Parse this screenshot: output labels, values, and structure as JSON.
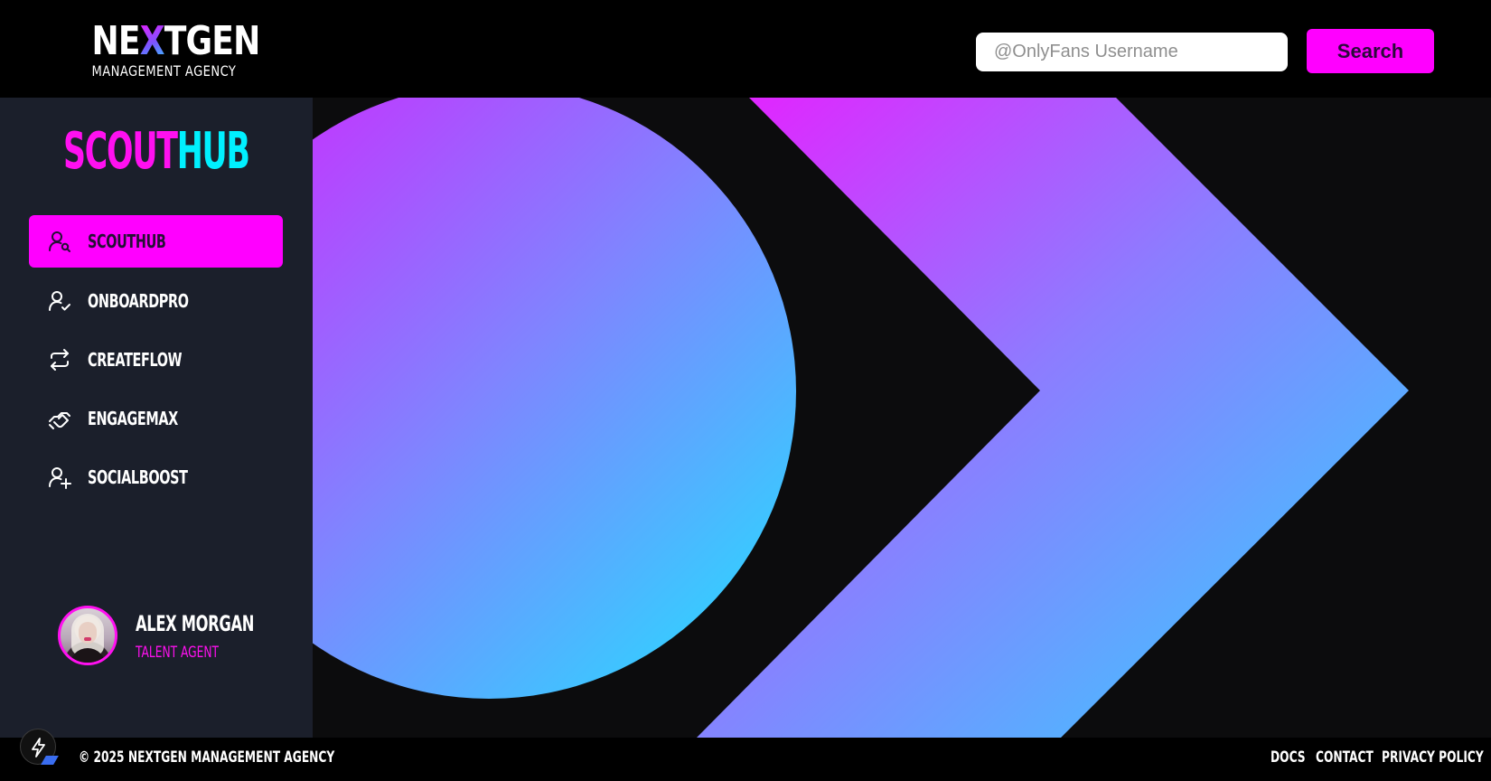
{
  "header": {
    "logo": {
      "ne": "NE",
      "x": "X",
      "tgen": "TGEN",
      "subtitle": "MANAGEMENT AGENCY"
    },
    "search": {
      "placeholder": "@OnlyFans Username",
      "value": "",
      "button_label": "Search"
    }
  },
  "sidebar": {
    "brand": {
      "part1": "SCOUT",
      "part2": "HUB"
    },
    "items": [
      {
        "label": "SCOUTHUB",
        "icon": "user-search-icon",
        "active": true
      },
      {
        "label": "ONBOARDPRO",
        "icon": "user-check-icon",
        "active": false
      },
      {
        "label": "CREATEFLOW",
        "icon": "repeat-icon",
        "active": false
      },
      {
        "label": "ENGAGEMAX",
        "icon": "handshake-icon",
        "active": false
      },
      {
        "label": "SOCIALBOOST",
        "icon": "user-plus-icon",
        "active": false
      }
    ],
    "profile": {
      "name": "ALEX MORGAN",
      "role": "TALENT AGENT"
    }
  },
  "footer": {
    "copyright": "© 2025 NEXTGEN MANAGEMENT AGENCY",
    "links": [
      "DOCS",
      "CONTACT",
      "PRIVACY POLICY"
    ]
  },
  "colors": {
    "accent_magenta": "#ff00ff",
    "accent_cyan": "#00f0ff",
    "sidebar_bg": "#1b1f2b",
    "hero_bg": "#0c0c0d",
    "gradient_start": "#d322ff",
    "gradient_mid": "#7f85ff",
    "gradient_end": "#1fe3ff"
  }
}
